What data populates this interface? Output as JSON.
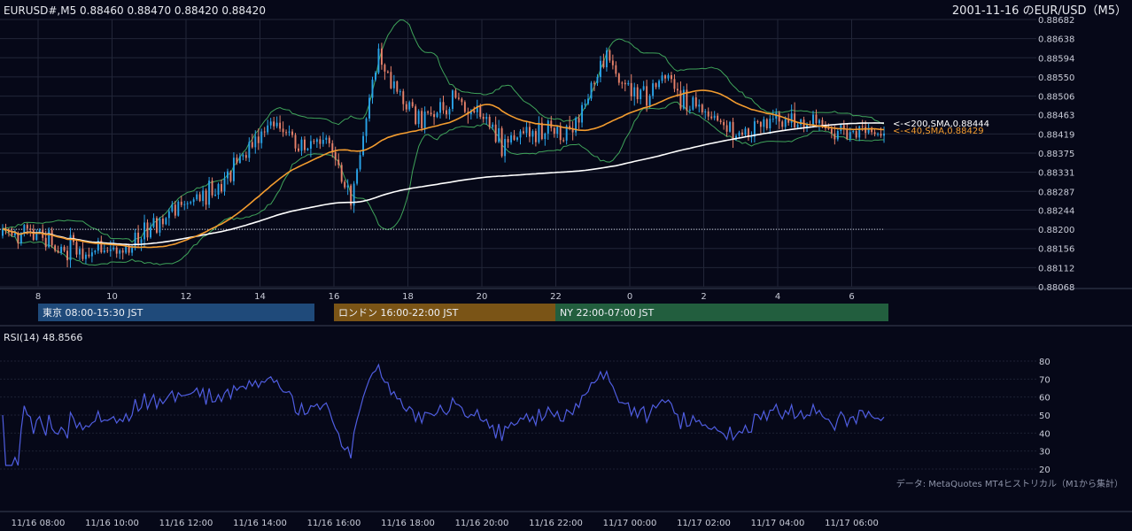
{
  "header": {
    "symbol_info": "EURUSD#,M5 0.88460 0.88470 0.88420 0.88420",
    "title_right": "2001-11-16 のEUR/USD（M5）"
  },
  "colors": {
    "background": "#060818",
    "grid": "#222638",
    "bull_candle": "#29a3e8",
    "bear_candle": "#e8826a",
    "sma40": "#f39c2f",
    "sma200": "#ffffff",
    "bollinger": "#3fa35a",
    "rsi_line": "#4f5de0",
    "session_tokyo": "#1f4a7a",
    "session_london": "#7a5416",
    "session_ny": "#225e3e"
  },
  "sessions": [
    {
      "label": "東京 08:00-15:30 JST",
      "color": "#1f4a7a"
    },
    {
      "label": "ロンドン 16:00-22:00 JST",
      "color": "#7a5416"
    },
    {
      "label": "NY 22:00-07:00 JST",
      "color": "#225e3e"
    }
  ],
  "sma_labels": {
    "sma200": "<-<200,SMA,0.88444",
    "sma40": "<-<40,SMA,0.88429"
  },
  "rsi": {
    "title": "RSI(14) 48.8566",
    "ticks": [
      "80",
      "70",
      "60",
      "50",
      "40",
      "30",
      "20"
    ]
  },
  "footer_note": "データ: MetaQuotes MT4ヒストリカル（M1から集計）",
  "chart_data": [
    {
      "type": "candlestick",
      "title": "2001-11-16 のEUR/USD（M5）",
      "ylim": [
        0.88068,
        0.88682
      ],
      "y_ticks": [
        "0.88682",
        "0.88638",
        "0.88594",
        "0.88550",
        "0.88506",
        "0.88463",
        "0.88419",
        "0.88375",
        "0.88331",
        "0.88287",
        "0.88244",
        "0.88200",
        "0.88156",
        "0.88112",
        "0.88068"
      ],
      "x_tick_labels": [
        "8",
        "10",
        "12",
        "14",
        "16",
        "18",
        "20",
        "22",
        "0",
        "2",
        "4",
        "6"
      ],
      "x_tick_hours": [
        8,
        10,
        12,
        14,
        16,
        18,
        20,
        22,
        24,
        26,
        28,
        30
      ],
      "x_start_hour": 7.0,
      "bar_minutes": 5,
      "reference_price": 0.882,
      "series": [
        {
          "name": "40,SMA",
          "last": 0.88429
        },
        {
          "name": "200,SMA",
          "last": 0.88444
        }
      ],
      "price_path": [
        [
          7.0,
          0.88185
        ],
        [
          8.0,
          0.8819
        ],
        [
          8.5,
          0.8816
        ],
        [
          9.5,
          0.88145
        ],
        [
          10.3,
          0.8815
        ],
        [
          11.0,
          0.882
        ],
        [
          12.0,
          0.8826
        ],
        [
          13.0,
          0.883
        ],
        [
          14.0,
          0.8842
        ],
        [
          14.5,
          0.8844
        ],
        [
          15.3,
          0.8838
        ],
        [
          15.8,
          0.8842
        ],
        [
          16.2,
          0.8833
        ],
        [
          16.5,
          0.8826
        ],
        [
          17.0,
          0.885
        ],
        [
          17.3,
          0.886
        ],
        [
          17.7,
          0.8852
        ],
        [
          18.5,
          0.8845
        ],
        [
          19.3,
          0.885
        ],
        [
          20.0,
          0.8847
        ],
        [
          20.5,
          0.884
        ],
        [
          21.0,
          0.8843
        ],
        [
          22.0,
          0.8842
        ],
        [
          22.5,
          0.8843
        ],
        [
          23.0,
          0.8852
        ],
        [
          23.4,
          0.886
        ],
        [
          23.8,
          0.8852
        ],
        [
          24.5,
          0.885
        ],
        [
          25.0,
          0.8856
        ],
        [
          25.5,
          0.885
        ],
        [
          26.0,
          0.8847
        ],
        [
          26.5,
          0.8844
        ],
        [
          27.0,
          0.8841
        ],
        [
          27.5,
          0.8844
        ],
        [
          28.0,
          0.8846
        ],
        [
          28.5,
          0.8844
        ],
        [
          29.0,
          0.8845
        ],
        [
          29.5,
          0.8843
        ],
        [
          30.0,
          0.8842
        ],
        [
          31.0,
          0.8842
        ]
      ],
      "last_close": 0.8842
    },
    {
      "type": "line",
      "title": "RSI(14) 48.8566",
      "ylim": [
        20,
        80
      ],
      "y_ticks": [
        80,
        70,
        60,
        50,
        40,
        30,
        20
      ],
      "last": 48.8566,
      "x_tick_labels": [
        "11/16 08:00",
        "11/16 10:00",
        "11/16 12:00",
        "11/16 14:00",
        "11/16 16:00",
        "11/16 18:00",
        "11/16 20:00",
        "11/16 22:00",
        "11/17 00:00",
        "11/17 02:00",
        "11/17 04:00",
        "11/17 06:00"
      ]
    }
  ]
}
